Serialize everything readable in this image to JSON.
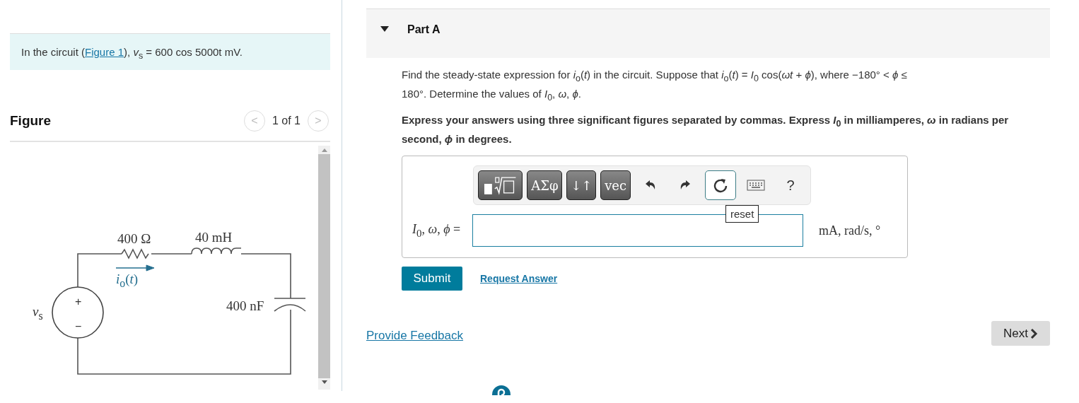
{
  "intro": {
    "prefix": "In the circuit (",
    "link": "Figure 1",
    "suffix": "), *v*$_{s}$ = 600 cos 5000t mV."
  },
  "figure": {
    "title": "Figure",
    "pager": "1 of 1",
    "prev": "<",
    "next": ">",
    "circuit": {
      "resistor": "400 Ω",
      "inductor": "40 mH",
      "capacitor": "400 nF",
      "current": "*i*$_{o}$(*t*)",
      "source": "*v*$_{s}$",
      "plus": "+",
      "minus": "−"
    }
  },
  "part": {
    "title": "Part A",
    "expanded": true,
    "question": "Find the steady-state expression for *i*$_{o}$(*t*) in the circuit. Suppose that *i*$_{o}$(*t*) = *I*$_{0}$ cos(*ωt* + *ϕ*), where −180° < *ϕ* ≤ 180°. Determine the values of *I*$_{0}$, *ω*, *ϕ*.",
    "instruction": "Express your answers using three significant figures separated by commas. Express *I*$_{0}$ in milliamperes, *ω* in radians per second, *ϕ* in degrees.",
    "toolbar": [
      {
        "kind": "template",
        "selected": false
      },
      {
        "kind": "text",
        "label": "ΑΣφ",
        "selected": false
      },
      {
        "kind": "text",
        "label": "↓↑",
        "selected": false
      },
      {
        "kind": "text",
        "label": "vec",
        "selected": false
      },
      {
        "kind": "undo",
        "selected": false
      },
      {
        "kind": "redo",
        "selected": false
      },
      {
        "kind": "reset",
        "selected": true
      },
      {
        "kind": "keyboard",
        "selected": false
      },
      {
        "kind": "plain",
        "label": "?",
        "selected": false
      }
    ],
    "tooltip": "reset",
    "answer_label": "*I*$_{0}$, *ω*, *ϕ* =",
    "units": "mA, rad/s, °",
    "submit": "Submit",
    "request": "Request Answer"
  },
  "feedback": "Provide Feedback",
  "next": "Next"
}
